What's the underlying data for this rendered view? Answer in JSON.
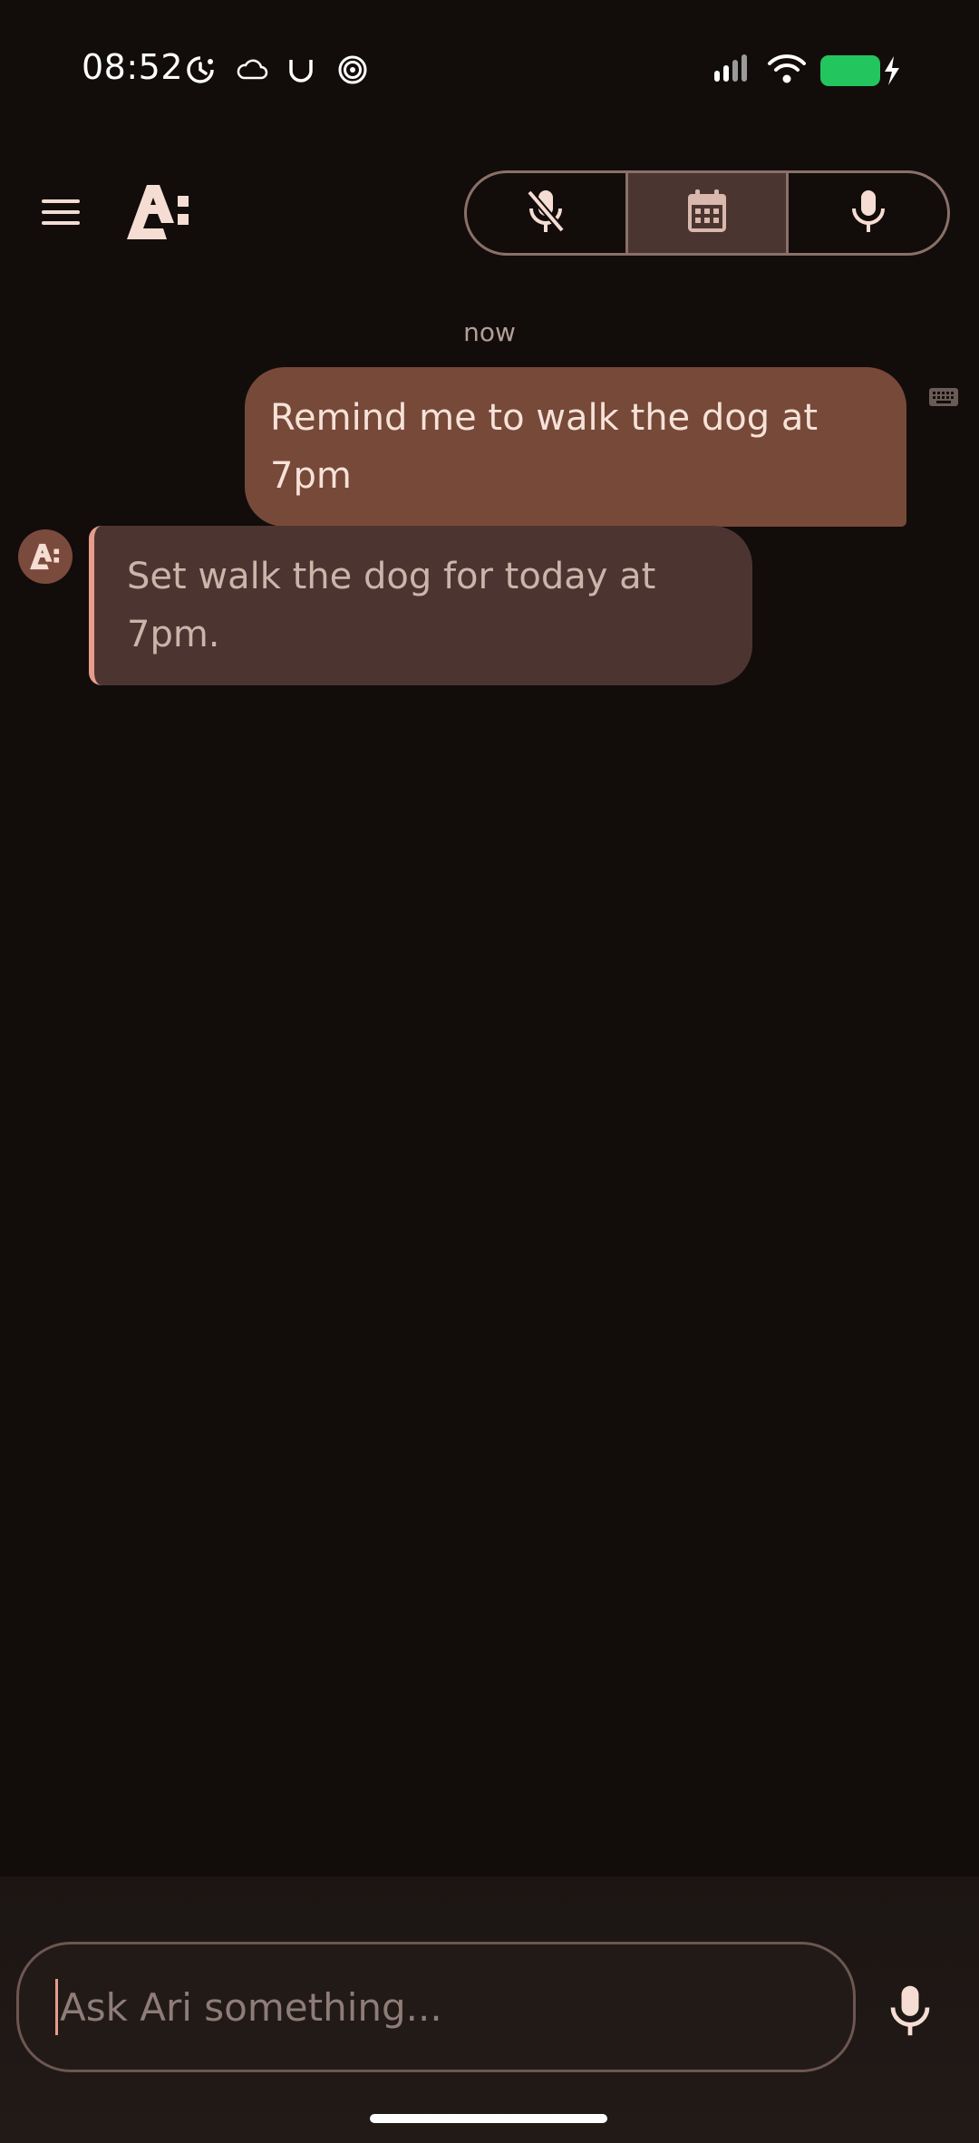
{
  "status_bar": {
    "time": "08:52",
    "icons": [
      "alarm-icon",
      "cloud-icon",
      "u-icon",
      "spiral-icon",
      "signal-icon",
      "wifi-icon",
      "battery-charging-icon"
    ],
    "battery_color": "#22c55e"
  },
  "header": {
    "menu_icon": "hamburger-menu-icon",
    "logo_icon": "ari-logo-icon",
    "modes": [
      {
        "name": "mic-off-icon",
        "active": false
      },
      {
        "name": "calendar-icon",
        "active": true
      },
      {
        "name": "mic-icon",
        "active": false
      }
    ]
  },
  "chat": {
    "timestamp": "now",
    "messages": [
      {
        "sender": "user",
        "text": "Remind me to walk the dog at 7pm",
        "input_method_icon": "keyboard-icon"
      },
      {
        "sender": "ari",
        "text": "Set walk the dog for today at 7pm."
      }
    ]
  },
  "composer": {
    "placeholder": "Ask Ari something...",
    "mic_icon": "mic-icon"
  },
  "colors": {
    "background": "#120d0b",
    "user_bubble": "#774939",
    "ari_bubble": "#4c3530",
    "accent": "#e79c8c"
  }
}
